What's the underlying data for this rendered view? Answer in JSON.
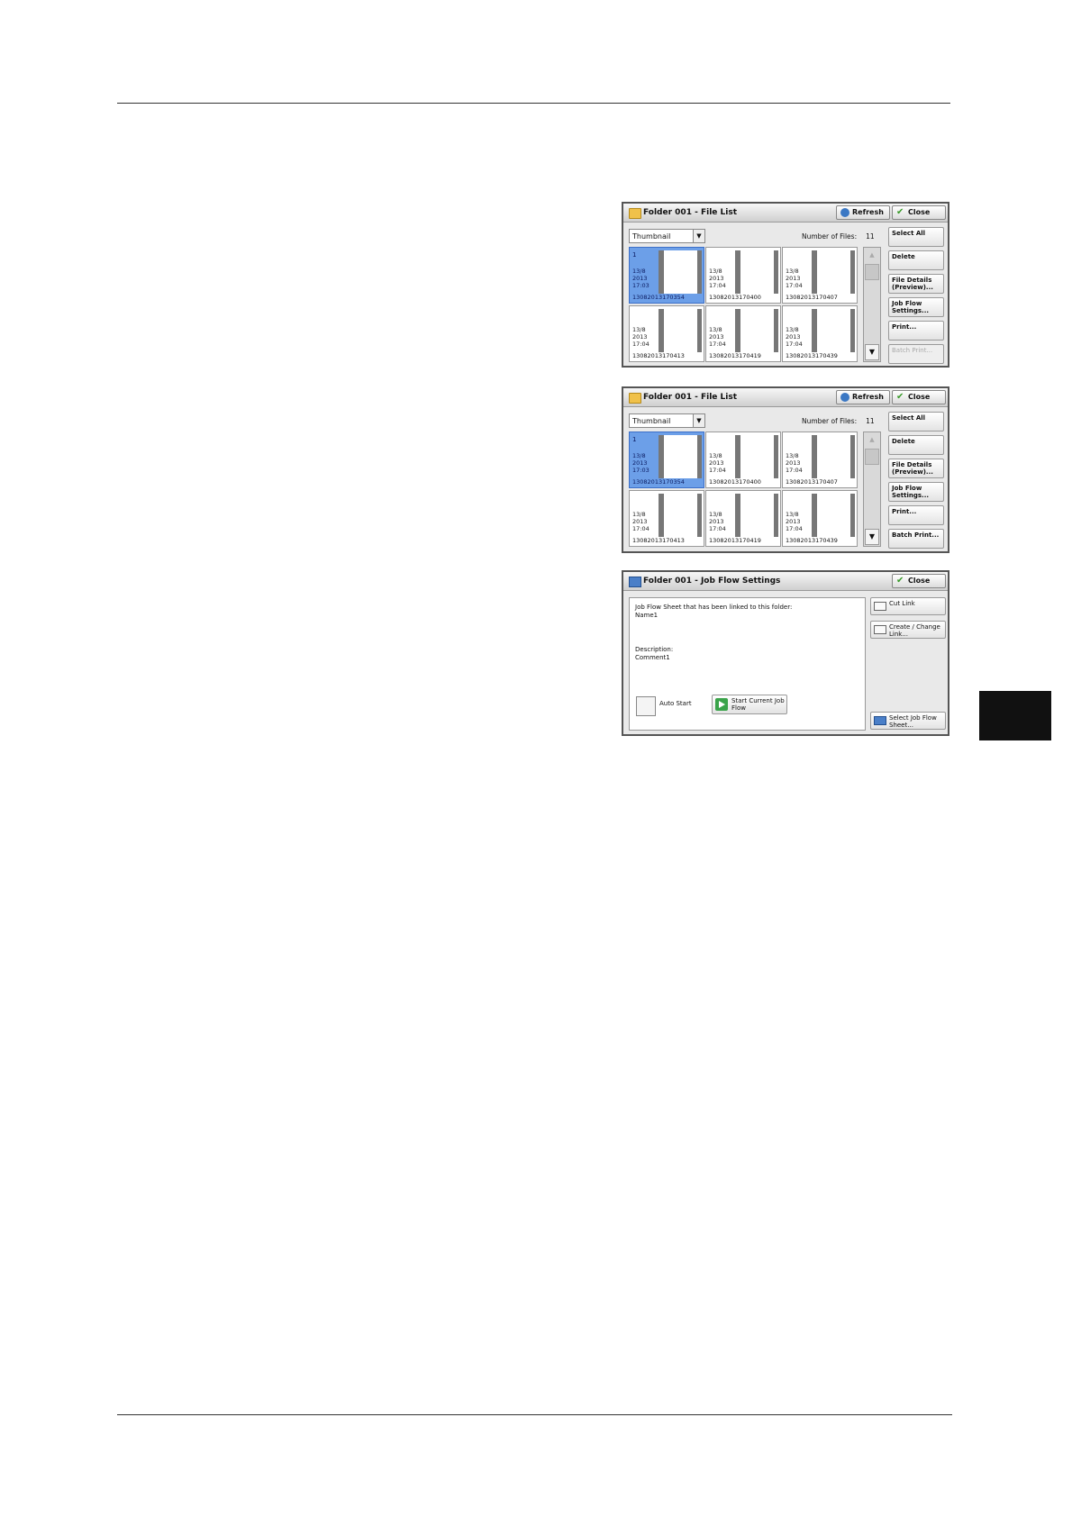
{
  "screens": [
    {
      "title": "Folder 001 - File List",
      "refresh": "Refresh",
      "close": "Close",
      "view_mode": "Thumbnail",
      "number_of_files_label": "Number of Files:",
      "number_of_files": "11",
      "files": [
        {
          "index": "1",
          "date": "13/8\n2013\n17:03",
          "name": "13082013170354",
          "selected": true
        },
        {
          "index": "",
          "date": "13/8\n2013\n17:04",
          "name": "13082013170400",
          "selected": false
        },
        {
          "index": "",
          "date": "13/8\n2013\n17:04",
          "name": "13082013170407",
          "selected": false
        },
        {
          "index": "",
          "date": "13/8\n2013\n17:04",
          "name": "13082013170413",
          "selected": false
        },
        {
          "index": "",
          "date": "13/8\n2013\n17:04",
          "name": "13082013170419",
          "selected": false
        },
        {
          "index": "",
          "date": "13/8\n2013\n17:04",
          "name": "13082013170439",
          "selected": false
        }
      ],
      "buttons": [
        "Select All",
        "Delete",
        "File Details (Preview)...",
        "Job Flow Settings...",
        "Print...",
        "Batch Print..."
      ],
      "batch_print_enabled": false
    },
    {
      "title": "Folder 001 - File List",
      "refresh": "Refresh",
      "close": "Close",
      "view_mode": "Thumbnail",
      "number_of_files_label": "Number of Files:",
      "number_of_files": "11",
      "files": [
        {
          "index": "1",
          "date": "13/8\n2013\n17:03",
          "name": "13082013170354",
          "selected": true
        },
        {
          "index": "",
          "date": "13/8\n2013\n17:04",
          "name": "13082013170400",
          "selected": false
        },
        {
          "index": "",
          "date": "13/8\n2013\n17:04",
          "name": "13082013170407",
          "selected": false
        },
        {
          "index": "",
          "date": "13/8\n2013\n17:04",
          "name": "13082013170413",
          "selected": false
        },
        {
          "index": "",
          "date": "13/8\n2013\n17:04",
          "name": "13082013170419",
          "selected": false
        },
        {
          "index": "",
          "date": "13/8\n2013\n17:04",
          "name": "13082013170439",
          "selected": false
        }
      ],
      "buttons": [
        "Select All",
        "Delete",
        "File Details (Preview)...",
        "Job Flow Settings...",
        "Print...",
        "Batch Print..."
      ],
      "batch_print_enabled": true
    }
  ],
  "jobflow": {
    "title": "Folder 001 - Job Flow Settings",
    "close": "Close",
    "linked_label": "Job Flow Sheet that has been linked to this folder:",
    "linked_name": "Name1",
    "description_label": "Description:",
    "description": "Comment1",
    "cut_link": "Cut Link",
    "create_change_link": "Create / Change Link...",
    "select_sheet": "Select Job Flow Sheet...",
    "auto_start": "Auto Start",
    "start_current": "Start Current Job Flow"
  }
}
